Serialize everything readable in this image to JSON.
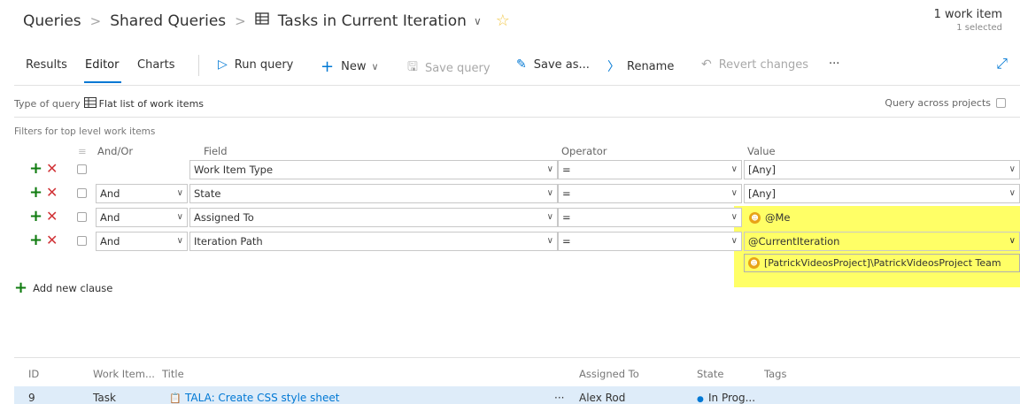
{
  "header": {
    "breadcrumb": [
      "Queries",
      "Shared Queries",
      "Tasks in Current Iteration"
    ],
    "work_item_count": "1 work item",
    "selected_count": "1 selected"
  },
  "toolbar": {
    "tabs": [
      "Results",
      "Editor",
      "Charts"
    ],
    "active_tab": "Editor",
    "run_query": "Run query",
    "new": "New",
    "save_query": "Save query",
    "save_as": "Save as...",
    "rename": "Rename",
    "revert": "Revert changes",
    "more": "···"
  },
  "query": {
    "type_label": "Type of query",
    "type_value": "Flat list of work items",
    "across_projects": "Query across projects",
    "filters_label": "Filters for top level work items"
  },
  "columns": {
    "andor": "And/Or",
    "field": "Field",
    "operator": "Operator",
    "value": "Value"
  },
  "clauses": [
    {
      "andor": "",
      "field": "Work Item Type",
      "operator": "=",
      "value": "[Any]"
    },
    {
      "andor": "And",
      "field": "State",
      "operator": "=",
      "value": "[Any]"
    },
    {
      "andor": "And",
      "field": "Assigned To",
      "operator": "=",
      "value": "@Me"
    },
    {
      "andor": "And",
      "field": "Iteration Path",
      "operator": "=",
      "value": "@CurrentIteration"
    }
  ],
  "iteration_team": "[PatrickVideosProject]\\PatrickVideosProject Team",
  "add_clause": "Add new clause",
  "results": {
    "headers": {
      "id": "ID",
      "type": "Work Item...",
      "title": "Title",
      "assigned": "Assigned To",
      "state": "State",
      "tags": "Tags"
    },
    "rows": [
      {
        "id": "9",
        "type": "Task",
        "title": "TALA: Create CSS style sheet",
        "assigned": "Alex Rod",
        "state": "In Prog..."
      }
    ]
  },
  "colors": {
    "accent": "#0078d4",
    "highlight": "#ffff66",
    "add": "#107c10",
    "delete": "#d13438"
  }
}
